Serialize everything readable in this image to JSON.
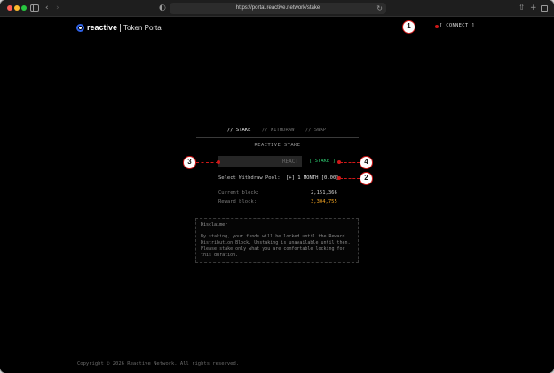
{
  "browser": {
    "url": "https://portal.reactive.network/stake",
    "back_icon": "‹",
    "forward_icon": "›",
    "shield_icon": "◐",
    "reload_icon": "↻",
    "share_icon": "⇧",
    "newtab_icon": "+"
  },
  "header": {
    "brand": "reactive",
    "subtitle": "Token Portal",
    "connect_label": "[ CONNECT ]"
  },
  "tabs": [
    {
      "label": "// STAKE",
      "active": true
    },
    {
      "label": "// WITHDRAW",
      "active": false
    },
    {
      "label": "// SWAP",
      "active": false
    }
  ],
  "stake": {
    "section_title": "REACTIVE STAKE",
    "amount_placeholder": "REACT",
    "stake_button": "[ STAKE ]",
    "withdraw_pool_label": "Select Withdraw Pool:",
    "withdraw_pool_value": "[+] 1 MONTH [0.00]",
    "current_block_label": "Current block:",
    "current_block_value": "2,151,366",
    "reward_block_label": "Reward block:",
    "reward_block_value": "3,304,755"
  },
  "disclaimer": {
    "title": "Disclaimer",
    "body": "By staking, your funds will be locked until the Reward Distribution Block. Unstaking is unavailable until then. Please stake only what you are comfortable locking for this duration."
  },
  "footer": {
    "copyright": "Copyright © 2026 Reactive Network. All rights reserved."
  },
  "annotations": {
    "m1": "1",
    "m2": "2",
    "m3": "3",
    "m4": "4"
  },
  "colors": {
    "accent_green": "#2ecc71",
    "accent_orange": "#f5a623",
    "brand_blue": "#2f62e8",
    "annotation_red": "#d01818"
  }
}
